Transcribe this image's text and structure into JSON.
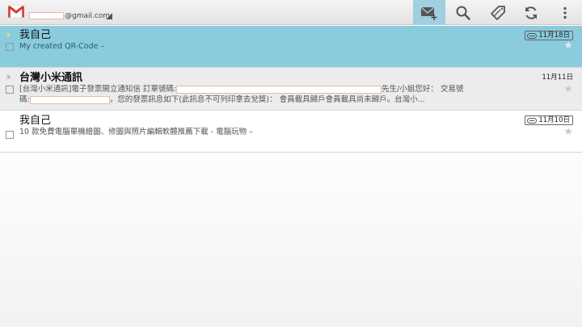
{
  "app": {
    "account_suffix": "@gmail.com",
    "accent_color": "#8acbde",
    "icons": [
      "gmail-logo",
      "compose-icon",
      "search-icon",
      "labels-icon",
      "refresh-icon",
      "overflow-menu-icon"
    ]
  },
  "conversations": [
    {
      "sender": "我自己",
      "snippet": "My created QR-Code –",
      "date": "11月18日",
      "has_attachment": true,
      "state": "selected",
      "important": true
    },
    {
      "sender": "台灣小米通訊",
      "snippet_line1_a": "[台灣小米通訊]電子發票開立通知信 訂單號碼:",
      "snippet_line1_b": "先生/小姐您好：  交易號",
      "snippet_line2_a": "碼:",
      "snippet_line2_b": "，您的發票訊息如下(此訊息不可列印拿去兌獎)：  會員載具歸戶會員載具尚未歸戶。台灣小...",
      "date": "11月11日",
      "has_attachment": false,
      "state": "unread",
      "important": true
    },
    {
      "sender": "我自己",
      "snippet": "10 款免費電腦單機繪圖、修圖與照片編輯軟體推薦下載 - 電腦玩物 –",
      "date": "11月10日",
      "has_attachment": true,
      "state": "read",
      "important": false
    }
  ]
}
